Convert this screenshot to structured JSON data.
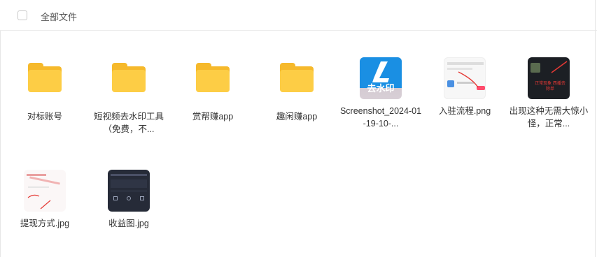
{
  "header": {
    "title": "全部文件"
  },
  "files": [
    {
      "name": "对标账号",
      "type": "folder"
    },
    {
      "name": "短视频去水印工具（免费，不...",
      "type": "folder"
    },
    {
      "name": "赏帮赚app",
      "type": "folder"
    },
    {
      "name": "趣闲赚app",
      "type": "folder"
    },
    {
      "name": "Screenshot_2024-01-19-10-...",
      "type": "image",
      "thumb_text": "去水印"
    },
    {
      "name": "入驻流程.png",
      "type": "image"
    },
    {
      "name": "出现这种无需大惊小怪，正常...",
      "type": "image",
      "thumb_text": "正常现象 西播去除单"
    },
    {
      "name": "提现方式.jpg",
      "type": "image"
    },
    {
      "name": "收益图.jpg",
      "type": "image"
    }
  ],
  "colors": {
    "folder_front": "#fdcd45",
    "folder_back": "#f6b92b",
    "accent_blue": "#1a8fe3"
  }
}
